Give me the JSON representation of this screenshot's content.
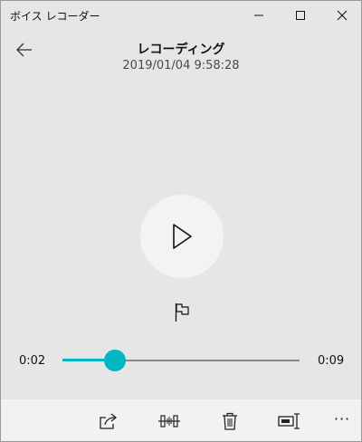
{
  "window": {
    "title": "ボイス レコーダー",
    "accent_color": "#00b7c3"
  },
  "recording": {
    "title": "レコーディング",
    "datetime": "2019/01/04 9:58:28"
  },
  "playback": {
    "current_time": "0:02",
    "total_time": "0:09",
    "progress_fraction": 0.22
  },
  "icons": {
    "back": "back-arrow-icon",
    "play": "play-icon",
    "flag": "flag-icon",
    "share": "share-icon",
    "trim": "trim-icon",
    "delete": "trash-icon",
    "rename": "rename-icon",
    "more": "more-icon"
  },
  "toolbar": {
    "more_label": "···"
  }
}
